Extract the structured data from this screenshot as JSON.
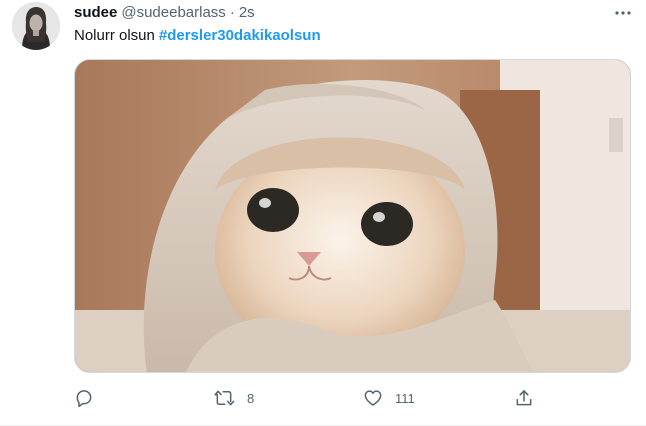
{
  "tweet": {
    "display_name": "sudee",
    "handle": "@sudeebarlass",
    "separator": "·",
    "timestamp": "2s",
    "text": "Nolurr olsun",
    "hashtag": "#dersler30dakikaolsun",
    "hashtag_color": "#1d9bf0"
  },
  "actions": {
    "reply": {
      "icon": "reply-icon",
      "count": ""
    },
    "retweet": {
      "icon": "retweet-icon",
      "count": "8"
    },
    "like": {
      "icon": "heart-icon",
      "count": "111"
    },
    "share": {
      "icon": "share-icon"
    }
  },
  "more_icon": "more-icon",
  "colors": {
    "text": "#0f1419",
    "secondary": "#536471",
    "border": "#cfd9de"
  }
}
